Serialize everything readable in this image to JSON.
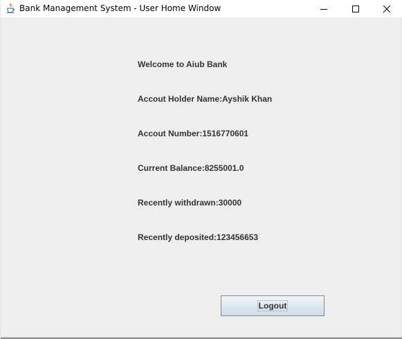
{
  "window": {
    "title": "Bank Management System - User Home Window",
    "icon": "java-cup-icon",
    "controls": [
      "minimize-icon",
      "maximize-icon",
      "close-icon"
    ]
  },
  "main": {
    "welcome": "Welcome to Aiub Bank",
    "account_holder": "Accout Holder Name:Ayshik Khan",
    "account_number": "Accout Number:1516770601",
    "current_balance": "Current Balance:8255001.0",
    "recently_withdrawn": "Recently withdrawn:30000",
    "recently_deposited": "Recently deposited:123456653",
    "logout_label": "Logout"
  },
  "colors": {
    "background": "#eeeeee",
    "titlebar": "#ffffff",
    "text": "#333333"
  }
}
